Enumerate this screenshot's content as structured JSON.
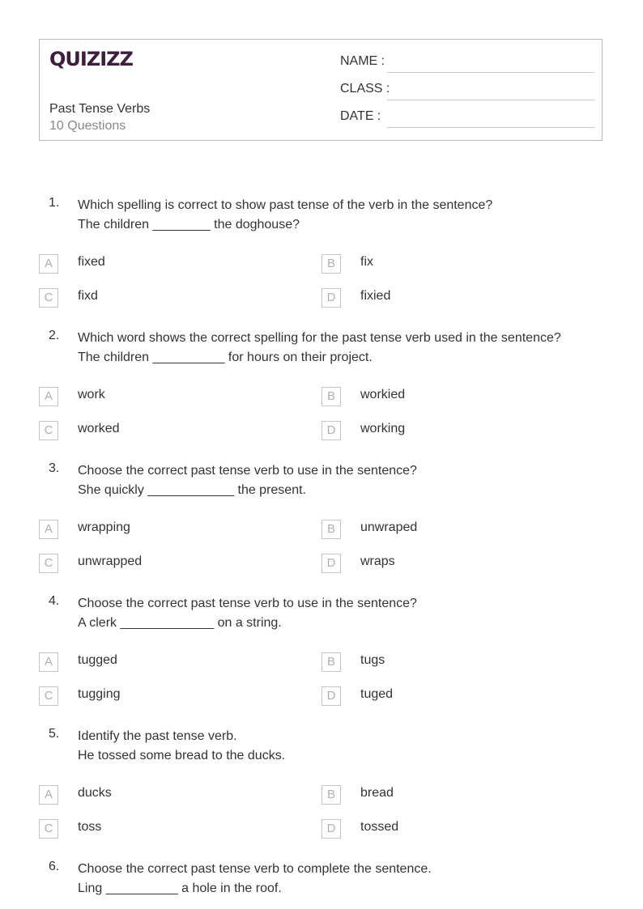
{
  "header": {
    "logo": "QUIZIZZ",
    "logo_color": "#3d1f3d",
    "title": "Past Tense Verbs",
    "question_count": "10 Questions",
    "fields": [
      {
        "label": "NAME :"
      },
      {
        "label": "CLASS :"
      },
      {
        "label": "DATE  :"
      }
    ]
  },
  "questions": [
    {
      "number": "1.",
      "prompt": "Which spelling is correct to show past tense of the verb in the sentence?",
      "sentence": "The children ________ the doghouse?",
      "options": [
        {
          "letter": "A",
          "text": "fixed"
        },
        {
          "letter": "B",
          "text": "fix"
        },
        {
          "letter": "C",
          "text": "fixd"
        },
        {
          "letter": "D",
          "text": "fixied"
        }
      ]
    },
    {
      "number": "2.",
      "prompt": "Which word shows the correct spelling for the past tense verb used in the sentence?",
      "sentence": "The children __________ for hours on their project.",
      "options": [
        {
          "letter": "A",
          "text": "work"
        },
        {
          "letter": "B",
          "text": "workied"
        },
        {
          "letter": "C",
          "text": "worked"
        },
        {
          "letter": "D",
          "text": "working"
        }
      ]
    },
    {
      "number": "3.",
      "prompt": "Choose the correct past tense verb to use in the sentence?",
      "sentence": "She quickly ____________ the present.",
      "options": [
        {
          "letter": "A",
          "text": "wrapping"
        },
        {
          "letter": "B",
          "text": "unwraped"
        },
        {
          "letter": "C",
          "text": "unwrapped"
        },
        {
          "letter": "D",
          "text": "wraps"
        }
      ]
    },
    {
      "number": "4.",
      "prompt": "Choose the correct past tense verb to use in the sentence?",
      "sentence": "A clerk _____________ on a string.",
      "options": [
        {
          "letter": "A",
          "text": "tugged"
        },
        {
          "letter": "B",
          "text": "tugs"
        },
        {
          "letter": "C",
          "text": "tugging"
        },
        {
          "letter": "D",
          "text": "tuged"
        }
      ]
    },
    {
      "number": "5.",
      "prompt": "Identify the past tense verb.",
      "sentence": "He tossed some bread to the ducks.",
      "options": [
        {
          "letter": "A",
          "text": "ducks"
        },
        {
          "letter": "B",
          "text": "bread"
        },
        {
          "letter": "C",
          "text": "toss"
        },
        {
          "letter": "D",
          "text": "tossed"
        }
      ]
    },
    {
      "number": "6.",
      "prompt": "Choose the correct past tense verb to complete the sentence.",
      "sentence": "Ling __________ a hole in the roof.",
      "options": []
    }
  ]
}
